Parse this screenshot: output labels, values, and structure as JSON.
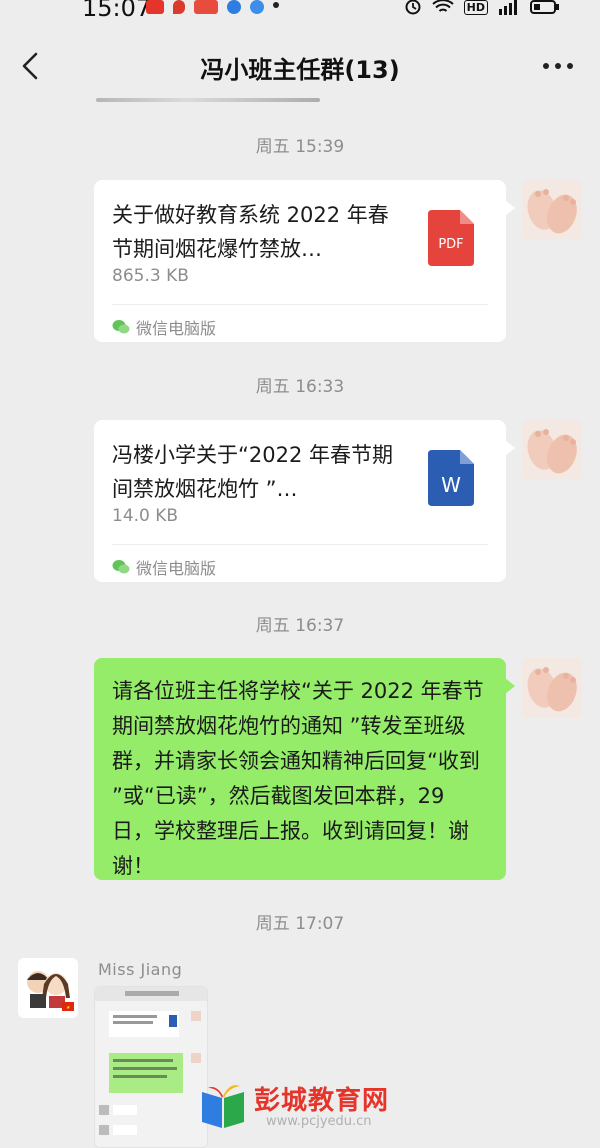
{
  "status_bar": {
    "time": "15:07",
    "indicators": "HD",
    "app_icon_colors": [
      "#e5352a",
      "#d93c2c",
      "#e74c3c",
      "#2f7de1",
      "#3c8ee8"
    ]
  },
  "nav": {
    "title": "冯小班主任群(13)",
    "back_icon": "chevron-left-icon",
    "more_icon": "more-dots-icon"
  },
  "messages": [
    {
      "time": "周五 15:39",
      "type": "file",
      "title": "关于做好教育系统 2022 年春节期间烟花爆竹禁放…",
      "size": "865.3 KB",
      "source": "微信电脑版",
      "file_icon": "pdf-file-icon",
      "file_icon_label": "PDF",
      "file_icon_color": "#e5443c"
    },
    {
      "time": "周五 16:33",
      "type": "file",
      "title": "冯楼小学关于“2022 年春节期间禁放烟花炮竹 ”…",
      "size": "14.0 KB",
      "source": "微信电脑版",
      "file_icon": "word-file-icon",
      "file_icon_label": "W",
      "file_icon_color": "#2b5eb3"
    },
    {
      "time": "周五 16:37",
      "type": "text",
      "text": "请各位班主任将学校“关于 2022 年春节期间禁放烟花炮竹的通知 ”转发至班级群，并请家长领会通知精神后回复“收到 ”或“已读”，然后截图发回本群，29 日，学校整理后上报。收到请回复！谢谢！",
      "bubble_color": "#95ec69"
    },
    {
      "time": "周五 17:07",
      "type": "image",
      "sender": "Miss  Jiang"
    }
  ],
  "watermark": {
    "text": "彭城教育网",
    "url": "www.pcjyedu.cn"
  }
}
